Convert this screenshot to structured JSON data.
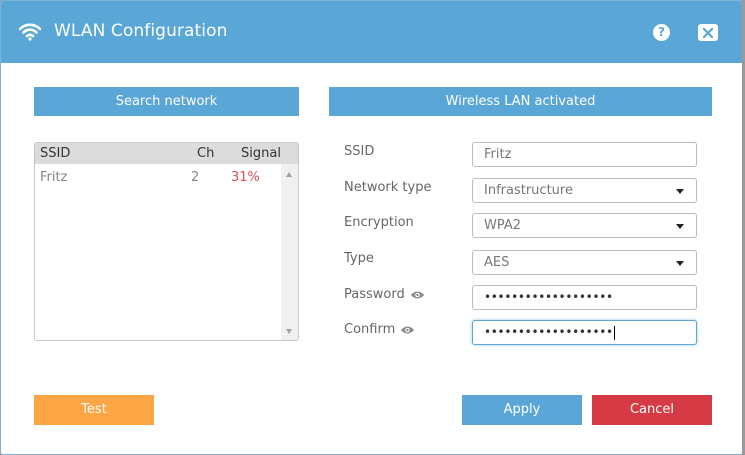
{
  "window": {
    "title": "WLAN Configuration",
    "help_icon": "?"
  },
  "left_panel": {
    "header": "Search network",
    "columns": [
      "SSID",
      "Ch",
      "Signal"
    ],
    "networks": [
      {
        "ssid": "Fritz",
        "ch": "2",
        "signal": "31%"
      }
    ]
  },
  "right_panel": {
    "header": "Wireless LAN activated",
    "fields": {
      "ssid": {
        "label": "SSID",
        "value": "Fritz"
      },
      "network_type": {
        "label": "Network type",
        "value": "Infrastructure"
      },
      "encryption": {
        "label": "Encryption",
        "value": "WPA2"
      },
      "type": {
        "label": "Type",
        "value": "AES"
      },
      "password": {
        "label": "Password",
        "value": "•••••••••••••••••••"
      },
      "confirm": {
        "label": "Confirm",
        "value": "•••••••••••••••••••"
      }
    }
  },
  "buttons": {
    "test": "Test",
    "apply": "Apply",
    "cancel": "Cancel"
  },
  "colors": {
    "accent": "#5aa6d6",
    "test": "#fda444",
    "cancel": "#d63a45",
    "signal": "#e05050"
  }
}
